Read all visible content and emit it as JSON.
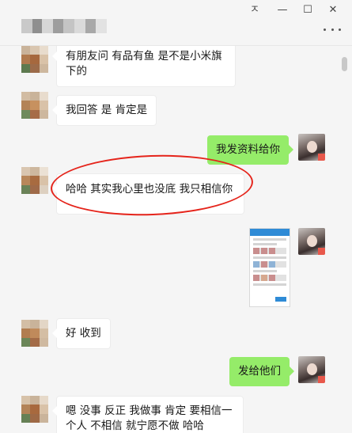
{
  "window": {
    "controls": {
      "pin": "ㅈ",
      "minimize": "—",
      "maximize": "☐",
      "close": "✕"
    },
    "more_icon": "more-dots-icon"
  },
  "messages": [
    {
      "side": "left",
      "text": "有朋友问  有品有鱼 是不是小米旗\n下的"
    },
    {
      "side": "left",
      "text": "我回答 是 肯定是"
    },
    {
      "side": "right",
      "text": "我发资料给你"
    },
    {
      "side": "left",
      "text": "哈哈 其实我心里也没底 我只相信你"
    },
    {
      "side": "right",
      "type": "image",
      "text": ""
    },
    {
      "side": "left",
      "text": "好 收到"
    },
    {
      "side": "right",
      "text": "发给他们"
    },
    {
      "side": "left",
      "text": "嗯 没事 反正 我做事 肯定 要相信一\n个人 不相信 就宁愿不做 哈哈"
    }
  ],
  "colors": {
    "bubble_right": "#95ec69",
    "bubble_left": "#ffffff",
    "background": "#f5f5f5",
    "annotation": "#e5241b"
  }
}
